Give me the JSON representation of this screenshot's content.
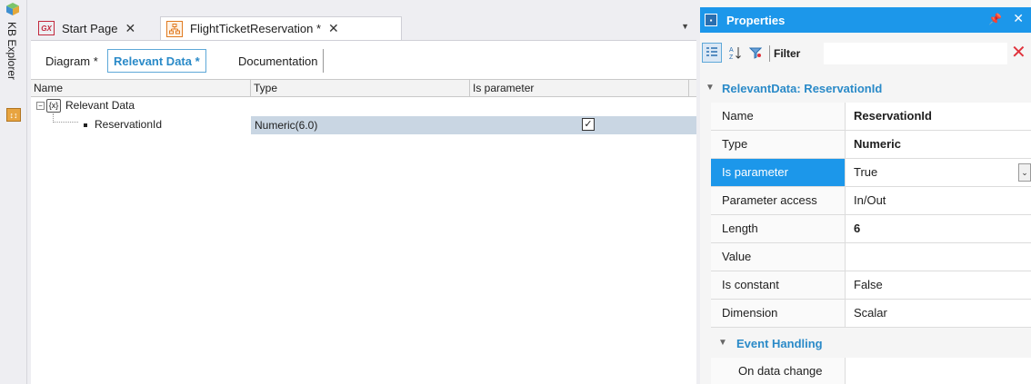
{
  "left_strip": {
    "tab_label": "KB Explorer"
  },
  "doc_tabs": {
    "start_page": "Start Page",
    "active_tab": "FlightTicketReservation *",
    "close": "✕"
  },
  "sub_tabs": {
    "diagram": "Diagram *",
    "relevant": "Relevant Data *",
    "documentation": "Documentation"
  },
  "grid": {
    "columns": [
      "Name",
      "Type",
      "Is parameter"
    ],
    "root_label": "Relevant Data",
    "child": {
      "name": "ReservationId",
      "type": "Numeric(6.0)",
      "is_parameter": "✓"
    }
  },
  "properties": {
    "title": "Properties",
    "filter_label": "Filter",
    "filter_value": "",
    "section_header": "RelevantData: ReservationId",
    "rows": [
      {
        "name": "Name",
        "value": "ReservationId"
      },
      {
        "name": "Type",
        "value": "Numeric"
      },
      {
        "name": "Is parameter",
        "value": "True"
      },
      {
        "name": "Parameter access",
        "value": "In/Out"
      },
      {
        "name": "Length",
        "value": "6"
      },
      {
        "name": "Value",
        "value": ""
      },
      {
        "name": "Is constant",
        "value": "False"
      },
      {
        "name": "Dimension",
        "value": "Scalar"
      }
    ],
    "event_header": "Event Handling",
    "event_row": {
      "name": "On data change",
      "value": ""
    }
  },
  "colors": {
    "accent": "#1c97ea",
    "link": "#2a8ac8",
    "selection": "#c9d6e3"
  }
}
